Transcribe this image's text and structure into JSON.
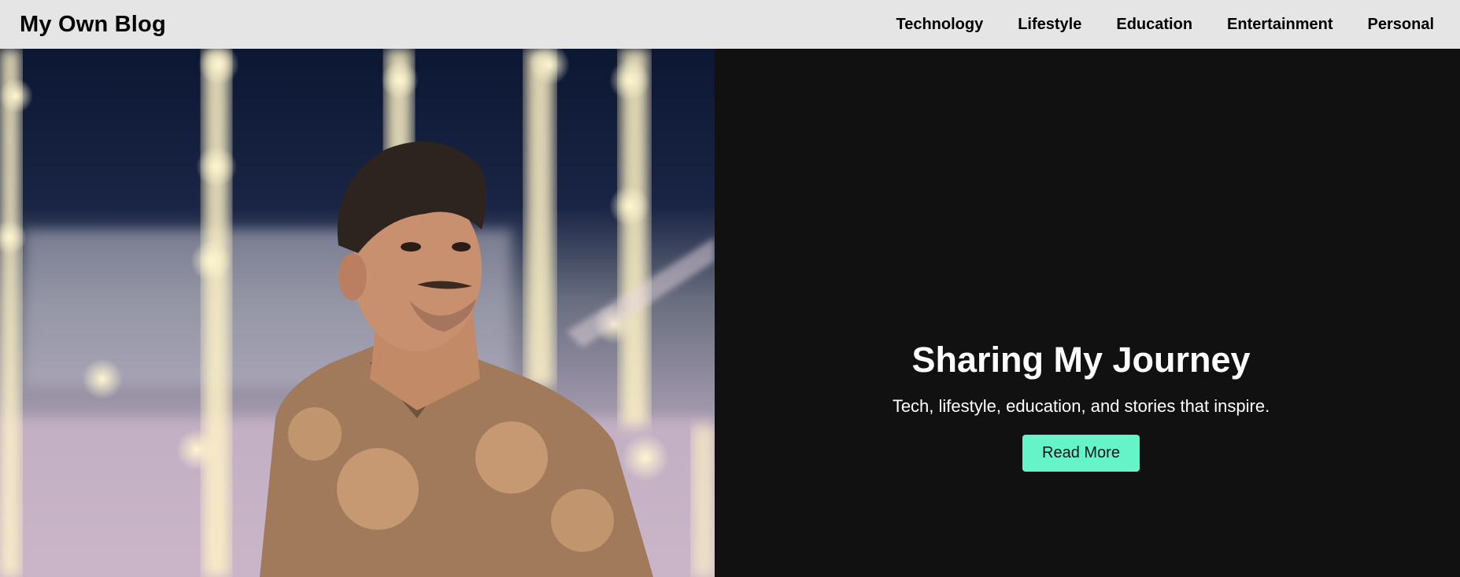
{
  "header": {
    "brand": "My Own Blog",
    "nav": [
      {
        "label": "Technology"
      },
      {
        "label": "Lifestyle"
      },
      {
        "label": "Education"
      },
      {
        "label": "Entertainment"
      },
      {
        "label": "Personal"
      }
    ]
  },
  "hero": {
    "title": "Sharing My Journey",
    "subtitle": "Tech, lifestyle, education, and stories that inspire.",
    "cta_label": "Read More"
  },
  "colors": {
    "nav_bg": "#e5e5e5",
    "hero_bg": "#111111",
    "cta_bg": "#64f4c8"
  }
}
